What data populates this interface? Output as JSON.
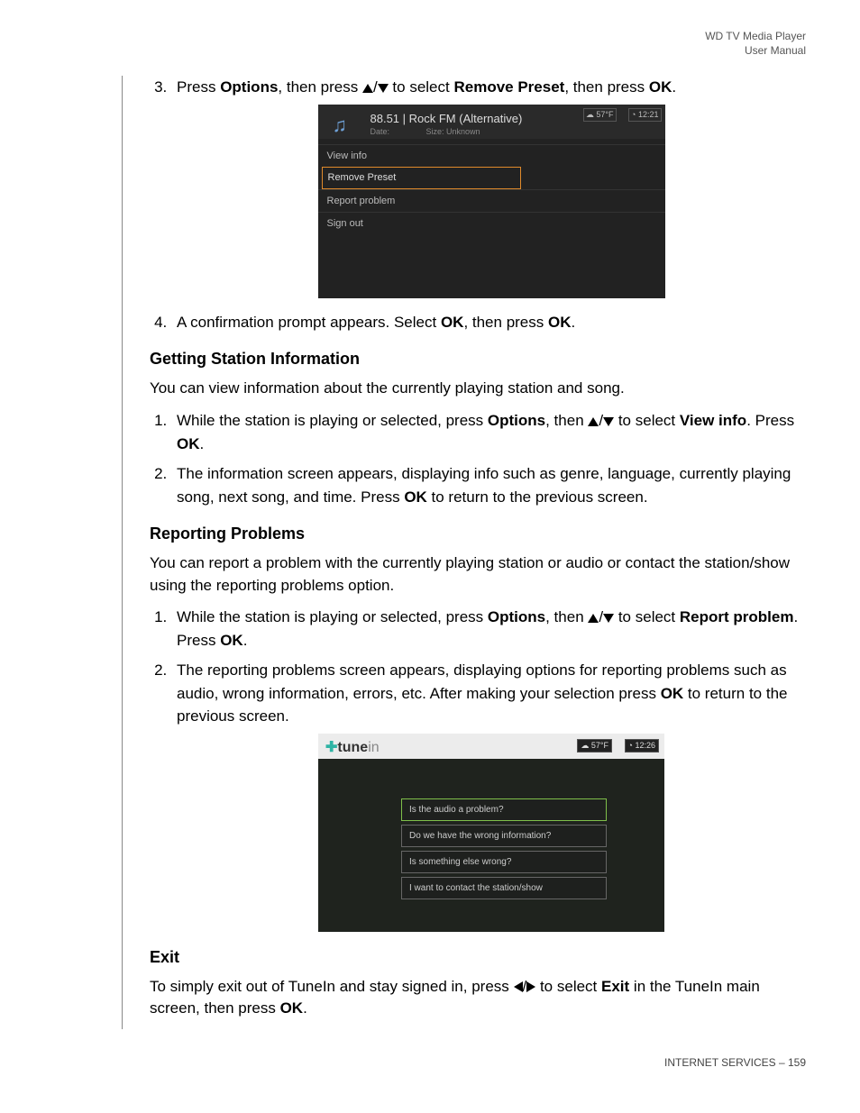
{
  "header": {
    "line1": "WD TV Media Player",
    "line2": "User Manual"
  },
  "steps_top": {
    "num3": "3.",
    "s3a": "Press ",
    "s3b": "Options",
    "s3c": ", then press ",
    "s3d": " to select ",
    "s3e": "Remove Preset",
    "s3f": ", then press ",
    "s3g": "OK",
    "s3h": ".",
    "num4": "4.",
    "s4a": "A confirmation prompt appears. Select ",
    "s4b": "OK",
    "s4c": ", then press ",
    "s4d": "OK",
    "s4e": "."
  },
  "shot1": {
    "title": "88.51 | Rock FM (Alternative)",
    "date_lbl": "Date:",
    "size_lbl": "Size: Unknown",
    "temp": "☁ 57°F",
    "time": "◔ 12:21",
    "menu": {
      "m1": "View info",
      "m2": "Remove Preset",
      "m3": "Report problem",
      "m4": "Sign out"
    }
  },
  "sec1": {
    "h": "Getting Station Information",
    "p": "You can view information about the currently playing station and song.",
    "li1a": "While the station is playing or selected, press ",
    "li1b": "Options",
    "li1c": ", then ",
    "li1d": " to select ",
    "li1e": "View info",
    "li1f": ". Press ",
    "li1g": "OK",
    "li1h": ".",
    "li2a": "The information screen appears, displaying info such as genre, language, currently playing song, next song, and time. Press ",
    "li2b": "OK",
    "li2c": " to return to the previous screen."
  },
  "sec2": {
    "h": "Reporting Problems",
    "p": "You can report a problem with the currently playing station or audio or contact the station/show using the reporting problems option.",
    "li1a": "While the station is playing or selected, press ",
    "li1b": "Options",
    "li1c": ", then ",
    "li1d": " to select ",
    "li1e": "Report problem",
    "li1f": ". Press ",
    "li1g": "OK",
    "li1h": ".",
    "li2a": "The reporting problems screen appears, displaying options for reporting problems such as audio, wrong information, errors, etc. After making your selection press ",
    "li2b": "OK",
    "li2c": " to return to the previous screen."
  },
  "shot2": {
    "logo_t": "tune",
    "logo_in": "in",
    "temp": "☁ 57°F",
    "time": "◔ 12:26",
    "o1": "Is the audio a problem?",
    "o2": "Do we have the wrong information?",
    "o3": "Is something else wrong?",
    "o4": "I want to contact the station/show"
  },
  "sec3": {
    "h": "Exit",
    "pa": "To simply exit out of TuneIn and stay signed in, press ",
    "pb": " to select ",
    "pc": "Exit",
    "pd": " in the TuneIn main screen, then press ",
    "pe": "OK",
    "pf": "."
  },
  "footer": {
    "a": "INTERNET SERVICES",
    "b": " – 159"
  },
  "sl": "/"
}
